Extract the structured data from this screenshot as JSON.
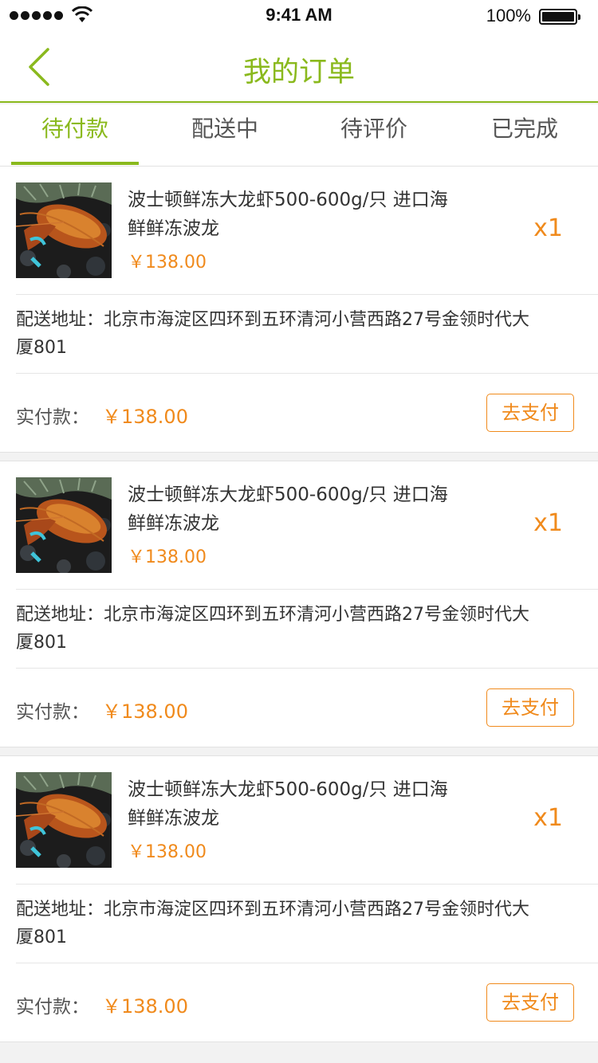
{
  "status_bar": {
    "time": "9:41 AM",
    "battery": "100%"
  },
  "nav": {
    "title": "我的订单",
    "back_icon": "chevron-left-icon",
    "accent_color": "#8ab91d"
  },
  "tabs": [
    {
      "label": "待付款",
      "active": true
    },
    {
      "label": "配送中",
      "active": false
    },
    {
      "label": "待评价",
      "active": false
    },
    {
      "label": "已完成",
      "active": false
    }
  ],
  "price_color": "#f08a1c",
  "orders": [
    {
      "product_name_line1": "波士顿鲜冻大龙虾500-600g/只 进口海",
      "product_name_line2": "鲜鲜冻波龙",
      "price": "￥138.00",
      "quantity": "x1",
      "address_line1": "配送地址：北京市海淀区四环到五环清河小营西路27号金领时代大",
      "address_line2": "厦801",
      "paid_label": "实付款：",
      "paid_amount": "￥138.00",
      "pay_button": "去支付"
    },
    {
      "product_name_line1": "波士顿鲜冻大龙虾500-600g/只 进口海",
      "product_name_line2": "鲜鲜冻波龙",
      "price": "￥138.00",
      "quantity": "x1",
      "address_line1": "配送地址：北京市海淀区四环到五环清河小营西路27号金领时代大",
      "address_line2": "厦801",
      "paid_label": "实付款：",
      "paid_amount": "￥138.00",
      "pay_button": "去支付"
    },
    {
      "product_name_line1": "波士顿鲜冻大龙虾500-600g/只 进口海",
      "product_name_line2": "鲜鲜冻波龙",
      "price": "￥138.00",
      "quantity": "x1",
      "address_line1": "配送地址：北京市海淀区四环到五环清河小营西路27号金领时代大",
      "address_line2": "厦801",
      "paid_label": "实付款：",
      "paid_amount": "￥138.00",
      "pay_button": "去支付"
    }
  ]
}
